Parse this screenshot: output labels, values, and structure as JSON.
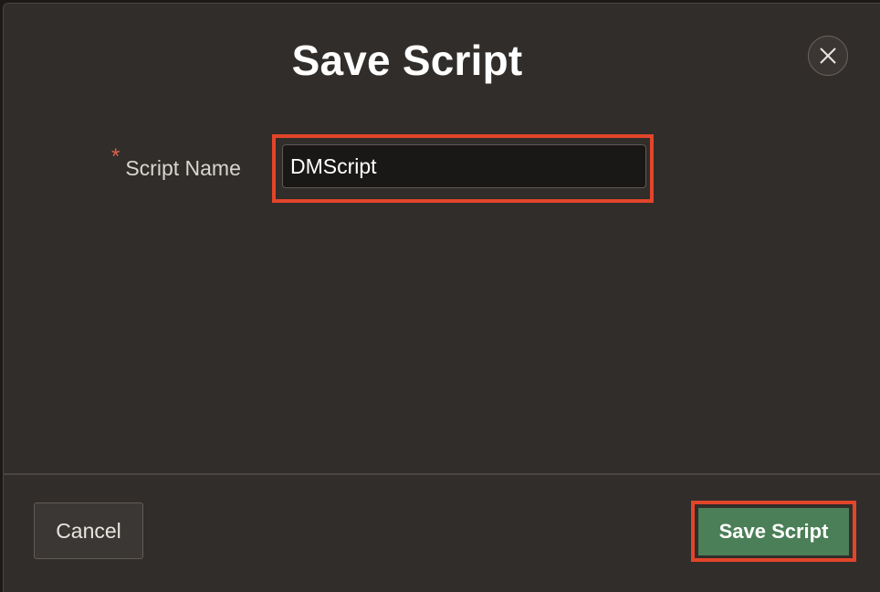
{
  "dialog": {
    "title": "Save Script",
    "close_icon": "close-icon"
  },
  "form": {
    "required_marker": "*",
    "script_name_label": "Script Name",
    "script_name_value": "DMScript"
  },
  "footer": {
    "cancel_label": "Cancel",
    "save_label": "Save Script"
  },
  "colors": {
    "dialog_background": "#312d2a",
    "primary_button": "#4b7f57",
    "highlight_border": "#e2452a",
    "required_marker": "#e0604a"
  }
}
